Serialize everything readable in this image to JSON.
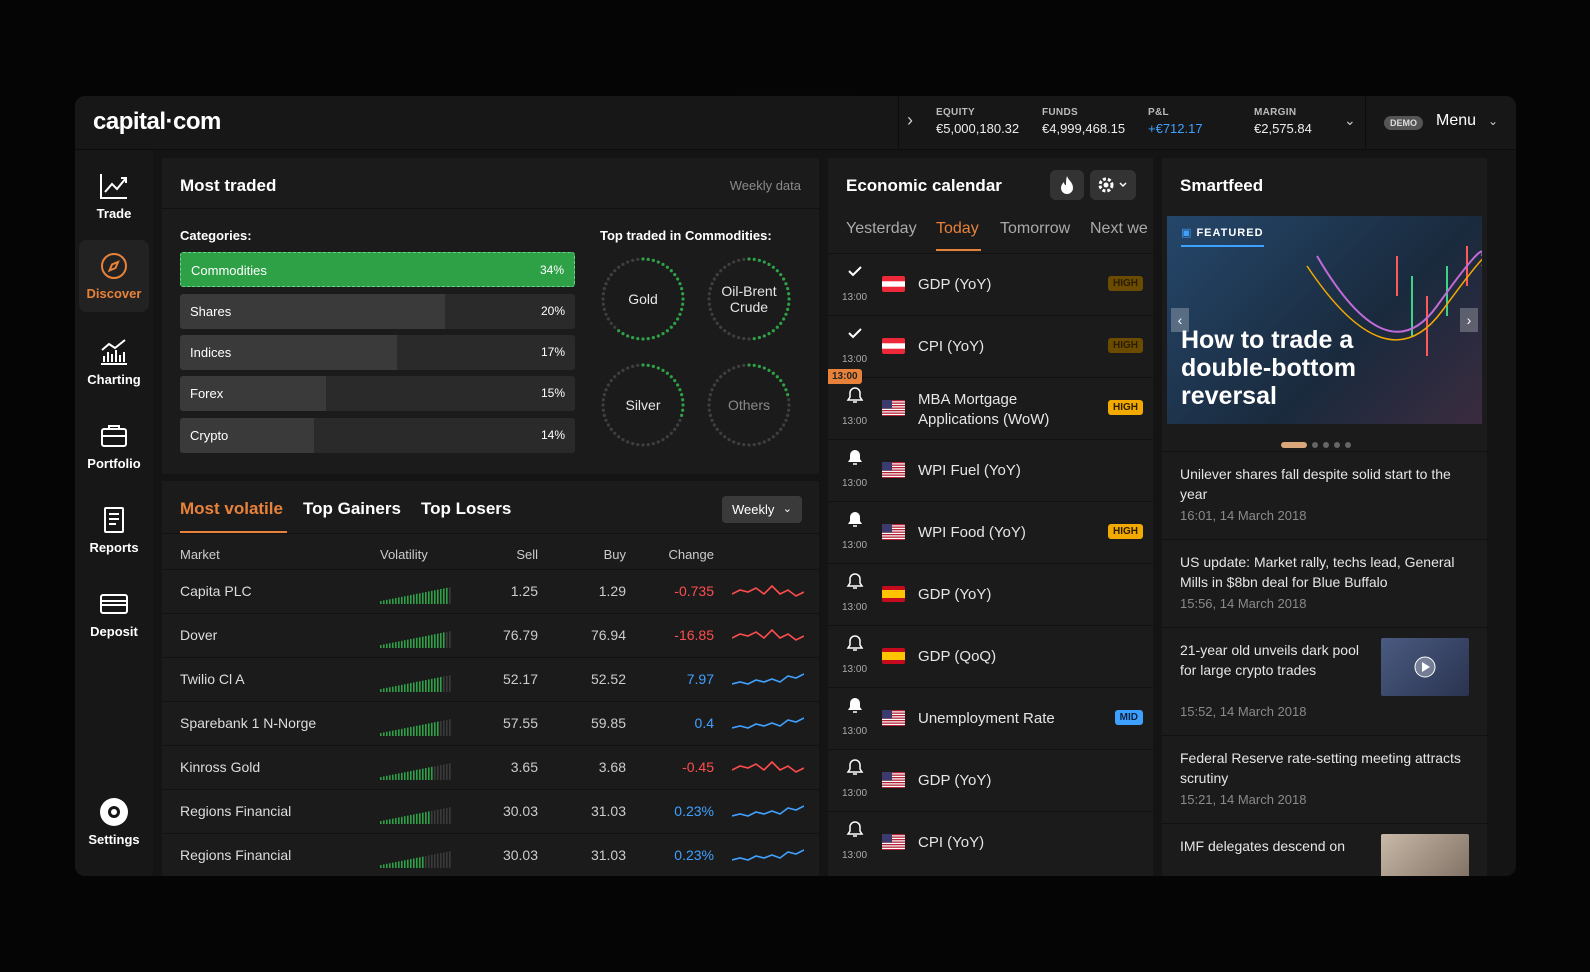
{
  "app": {
    "logo": "capital·com"
  },
  "account": {
    "items": [
      {
        "label": "EQUITY",
        "value": "€5,000,180.32"
      },
      {
        "label": "FUNDS",
        "value": "€4,999,468.15"
      },
      {
        "label": "P&L",
        "value": "+€712.17"
      },
      {
        "label": "MARGIN",
        "value": "€2,575.84"
      }
    ],
    "demo_badge": "DEMO",
    "menu_label": "Menu"
  },
  "sidebar": {
    "items": [
      {
        "label": "Trade",
        "icon": "trade-chart-icon"
      },
      {
        "label": "Discover",
        "icon": "compass-icon",
        "active": true
      },
      {
        "label": "Charting",
        "icon": "charting-icon"
      },
      {
        "label": "Portfolio",
        "icon": "briefcase-icon"
      },
      {
        "label": "Reports",
        "icon": "reports-icon"
      },
      {
        "label": "Deposit",
        "icon": "card-icon"
      },
      {
        "label": "Settings",
        "icon": "gear-icon"
      }
    ]
  },
  "most_traded": {
    "title": "Most traded",
    "period": "Weekly data",
    "categories_label": "Categories:",
    "categories": [
      {
        "name": "Commodities",
        "percent": "34%",
        "share": 1.0,
        "active": true
      },
      {
        "name": "Shares",
        "percent": "20%",
        "share": 0.67
      },
      {
        "name": "Indices",
        "percent": "17%",
        "share": 0.55
      },
      {
        "name": "Forex",
        "percent": "15%",
        "share": 0.37
      },
      {
        "name": "Crypto",
        "percent": "14%",
        "share": 0.34
      }
    ],
    "top_label": "Top traded in Commodities:",
    "top_items": [
      {
        "name": "Gold",
        "level": 0.62
      },
      {
        "name": "Oil-Brent Crude",
        "level": 0.48
      },
      {
        "name": "Silver",
        "level": 0.3
      },
      {
        "name": "Others",
        "level": 0.22
      }
    ]
  },
  "volatile": {
    "tabs": [
      "Most volatile",
      "Top Gainers",
      "Top Losers"
    ],
    "period_select": "Weekly",
    "headers": [
      "Market",
      "Volatility",
      "Sell",
      "Buy",
      "Change"
    ],
    "rows": [
      {
        "market": "Capita PLC",
        "sell": "1.25",
        "buy": "1.29",
        "change": "-0.735",
        "dir": "neg"
      },
      {
        "market": "Dover",
        "sell": "76.79",
        "buy": "76.94",
        "change": "-16.85",
        "dir": "neg"
      },
      {
        "market": "Twilio Cl A",
        "sell": "52.17",
        "buy": "52.52",
        "change": "7.97",
        "dir": "pos"
      },
      {
        "market": "Sparebank 1 N-Norge",
        "sell": "57.55",
        "buy": "59.85",
        "change": "0.4",
        "dir": "pos"
      },
      {
        "market": "Kinross Gold",
        "sell": "3.65",
        "buy": "3.68",
        "change": "-0.45",
        "dir": "neg"
      },
      {
        "market": "Regions Financial",
        "sell": "30.03",
        "buy": "31.03",
        "change": "0.23%",
        "dir": "pos"
      },
      {
        "market": "Regions Financial",
        "sell": "30.03",
        "buy": "31.03",
        "change": "0.23%",
        "dir": "pos"
      }
    ]
  },
  "calendar": {
    "title": "Economic calendar",
    "days": [
      "Yesterday",
      "Today",
      "Tomorrow",
      "Next we"
    ],
    "now_tag": "13:00",
    "events": [
      {
        "name": "GDP (YoY)",
        "time": "13:00",
        "status": "done",
        "flag": "at",
        "badge": "HIGH",
        "badge_type": "high dim"
      },
      {
        "name": "CPI (YoY)",
        "time": "13:00",
        "status": "done",
        "flag": "at",
        "badge": "HIGH",
        "badge_type": "high dim"
      },
      {
        "name": "MBA Mortgage Applications (WoW)",
        "time": "13:00",
        "status": "bell",
        "flag": "us",
        "badge": "HIGH",
        "badge_type": "high"
      },
      {
        "name": "WPI Fuel (YoY)",
        "time": "13:00",
        "status": "bell-filled",
        "flag": "us",
        "badge": "",
        "badge_type": ""
      },
      {
        "name": "WPI Food (YoY)",
        "time": "13:00",
        "status": "bell-filled",
        "flag": "us",
        "badge": "HIGH",
        "badge_type": "high"
      },
      {
        "name": "GDP (YoY)",
        "time": "13:00",
        "status": "bell",
        "flag": "es",
        "badge": "",
        "badge_type": ""
      },
      {
        "name": "GDP (QoQ)",
        "time": "13:00",
        "status": "bell",
        "flag": "es",
        "badge": "",
        "badge_type": ""
      },
      {
        "name": "Unemployment Rate",
        "time": "13:00",
        "status": "bell-filled",
        "flag": "us",
        "badge": "MID",
        "badge_type": "mid"
      },
      {
        "name": "GDP (YoY)",
        "time": "13:00",
        "status": "bell",
        "flag": "us",
        "badge": "",
        "badge_type": ""
      },
      {
        "name": "CPI (YoY)",
        "time": "13:00",
        "status": "bell",
        "flag": "us",
        "badge": "",
        "badge_type": ""
      }
    ]
  },
  "smartfeed": {
    "title": "Smartfeed",
    "featured_tag": "FEATURED",
    "featured_title": "How to trade a double-bottom reversal",
    "news": [
      {
        "title": "Unilever shares fall despite solid start to the year",
        "date": "16:01, 14 March 2018"
      },
      {
        "title": "US update: Market rally, techs lead, General Mills in $8bn deal for Blue Buffalo",
        "date": "15:56, 14 March 2018"
      },
      {
        "title": "21-year old unveils dark pool for large crypto trades",
        "date": "15:52, 14 March 2018",
        "thumb": true
      },
      {
        "title": "Federal Reserve rate-setting meeting attracts scrutiny",
        "date": "15:21, 14 March 2018"
      },
      {
        "title": "IMF delegates descend on",
        "date": "",
        "thumb": true
      }
    ]
  }
}
